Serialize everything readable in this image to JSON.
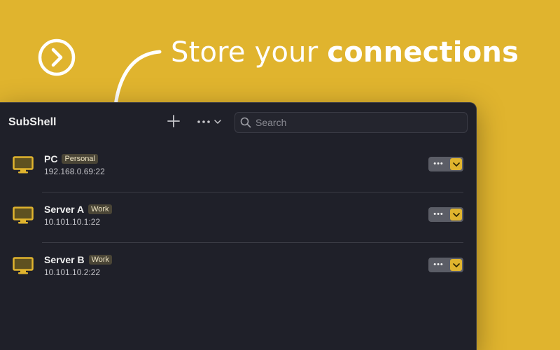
{
  "promo": {
    "headline_prefix": "Store your ",
    "headline_bold": "connections",
    "logo_icon": "arrow-circle-icon",
    "arrow_icon": "curved-arrow-icon"
  },
  "colors": {
    "background": "#E0B42E",
    "window": "#1F2029",
    "accent": "#E0B42E"
  },
  "app": {
    "title": "SubShell",
    "add_icon": "plus-icon",
    "more_icon": "ellipsis-icon",
    "search": {
      "placeholder": "Search",
      "value": ""
    }
  },
  "connections": [
    {
      "name": "PC",
      "tag": "Personal",
      "address": "192.168.0.69:22",
      "icon": "monitor-icon"
    },
    {
      "name": "Server A",
      "tag": "Work",
      "address": "10.101.10.1:22",
      "icon": "monitor-icon"
    },
    {
      "name": "Server B",
      "tag": "Work",
      "address": "10.101.10.2:22",
      "icon": "monitor-icon"
    }
  ]
}
